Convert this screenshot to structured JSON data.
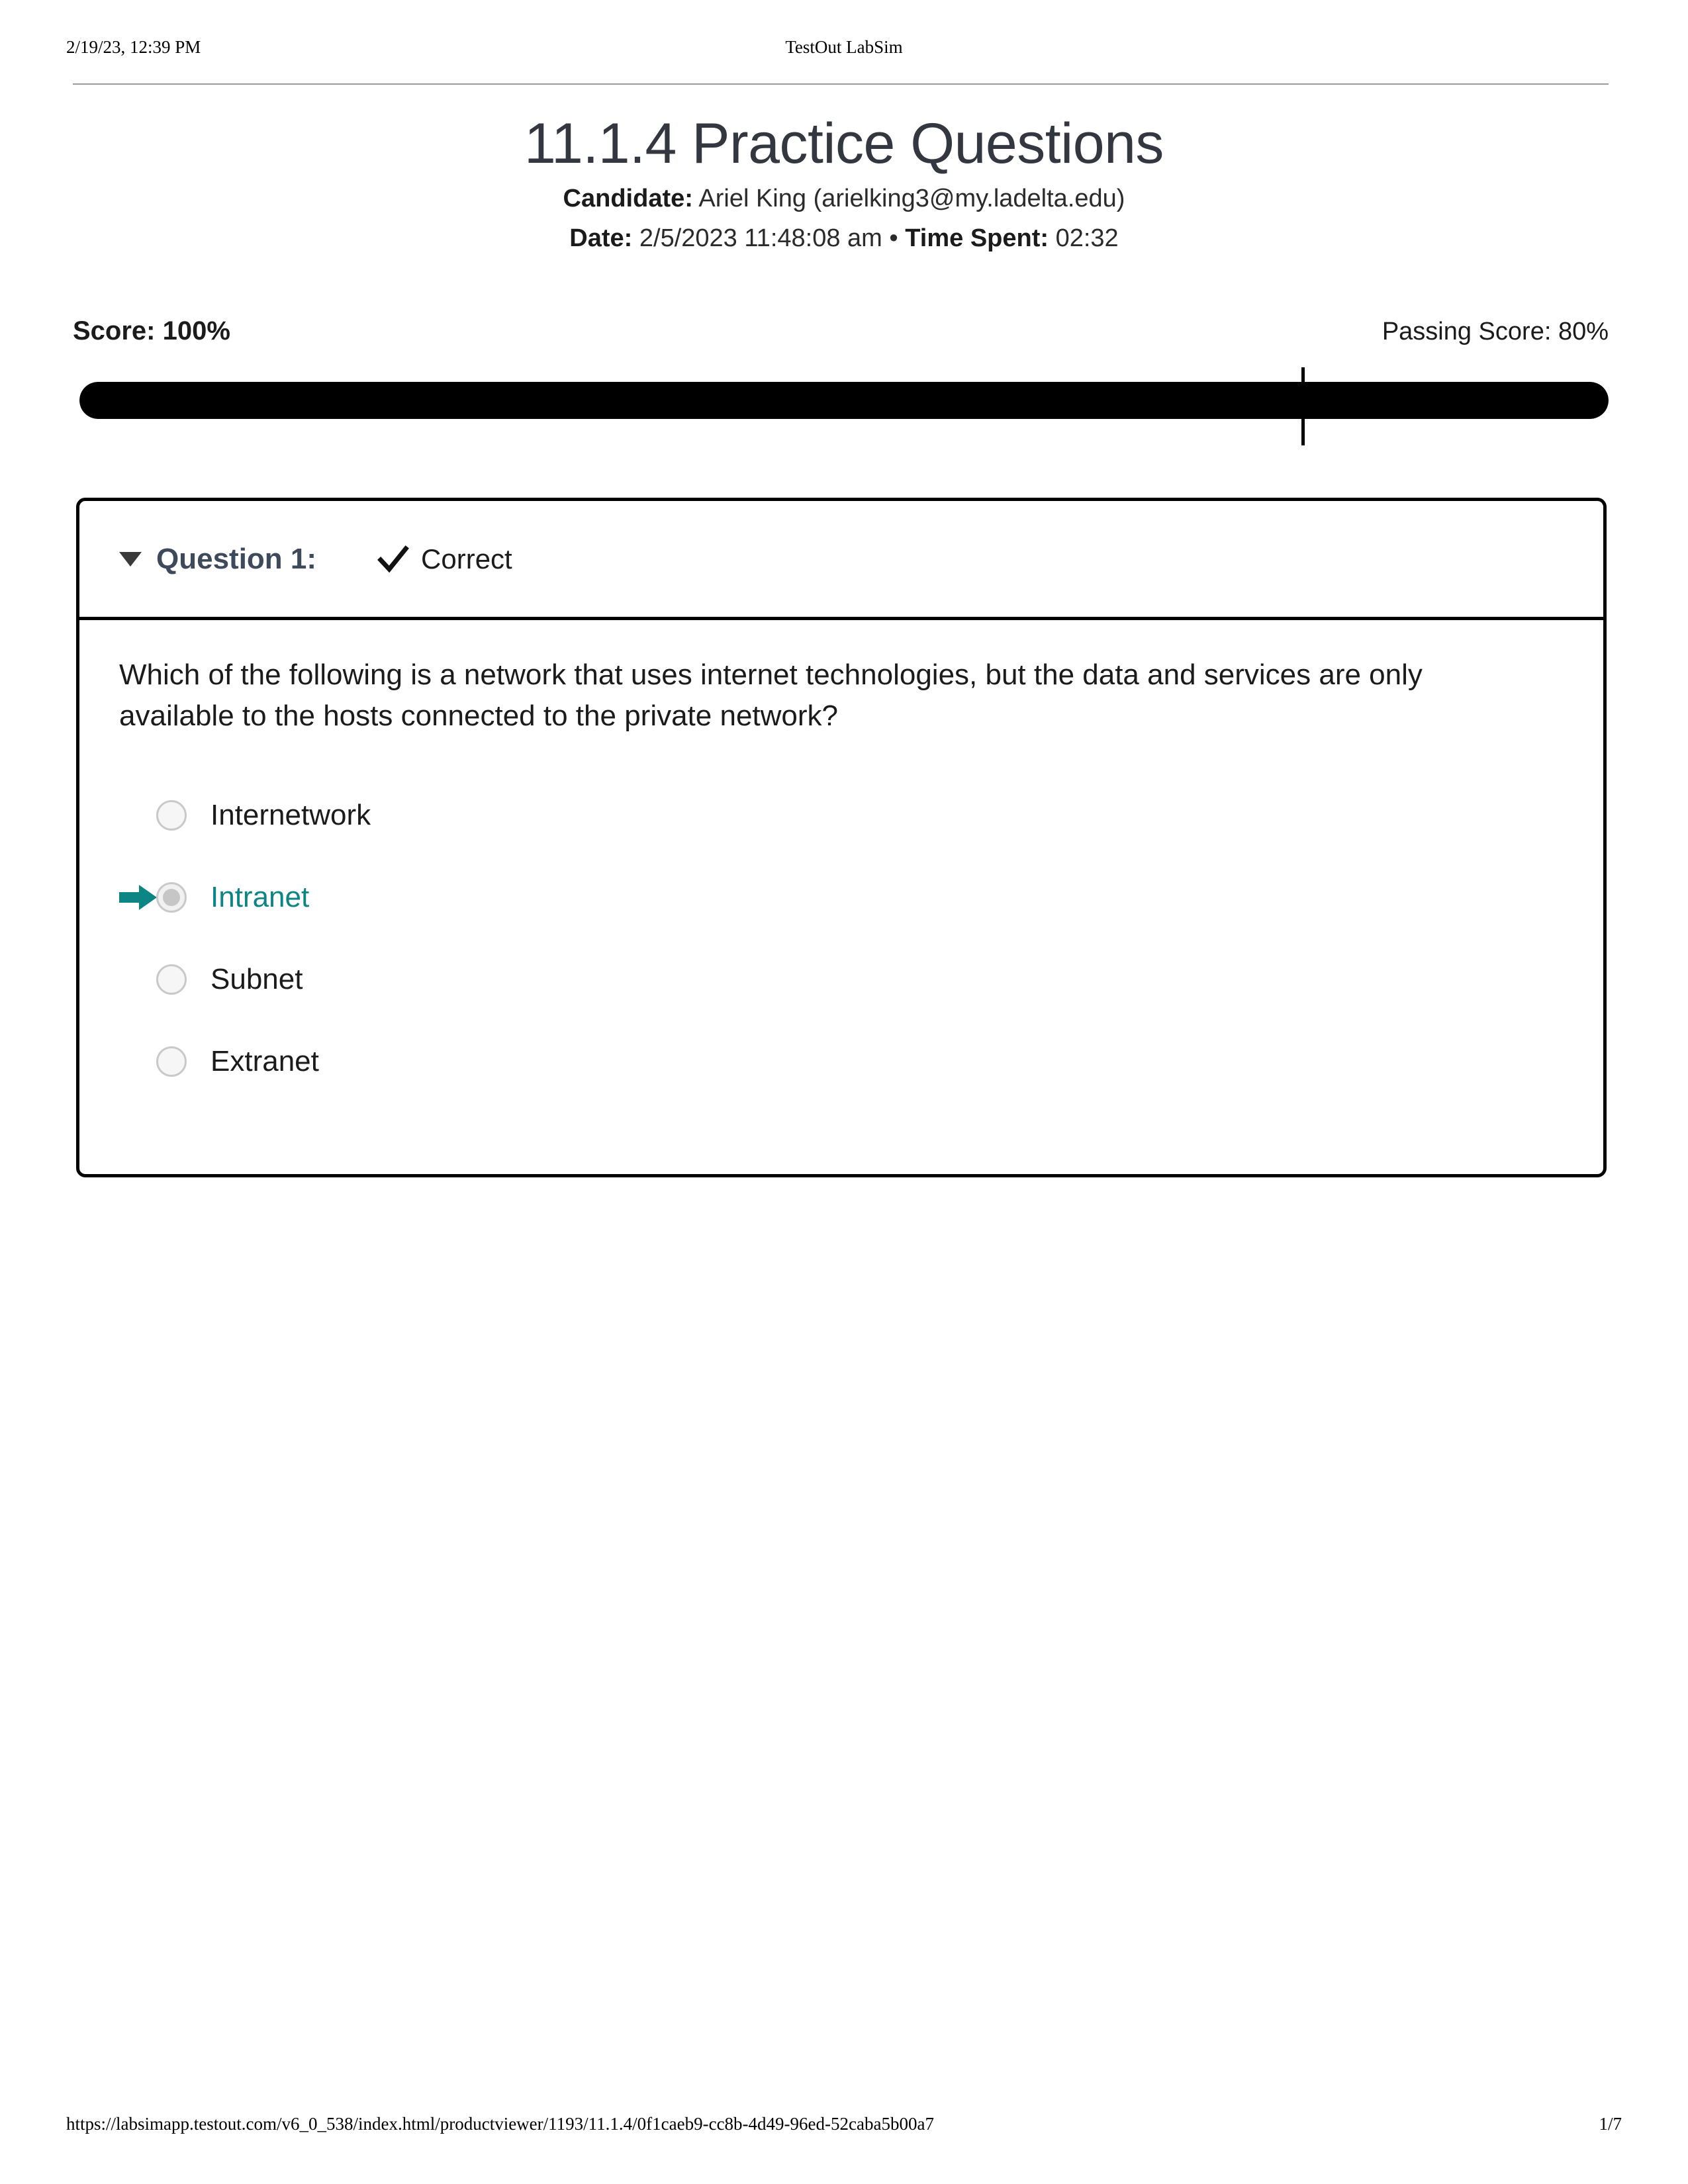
{
  "print_header": {
    "left": "2/19/23, 12:39 PM",
    "center": "TestOut LabSim"
  },
  "title": "11.1.4 Practice Questions",
  "meta": {
    "candidate_label": "Candidate:",
    "candidate_value": "Ariel King  (arielking3@my.ladelta.edu)",
    "date_label": "Date:",
    "date_value": "2/5/2023 11:48:08 am",
    "separator": "•",
    "time_spent_label": "Time Spent:",
    "time_spent_value": "02:32"
  },
  "score": {
    "score_text": "Score: 100%",
    "passing_text": "Passing Score: 80%",
    "score_percent": 100,
    "passing_percent": 80,
    "bar_fill_color": "#000000",
    "bar_track_color": "#e9e9e9",
    "tick_color": "#000000"
  },
  "question": {
    "caret_icon": "caret-down-icon",
    "label": "Question 1:",
    "status_icon": "checkmark-icon",
    "status_text": "Correct",
    "text": "Which of the following is a network that uses internet technologies, but the data and services are only available to the hosts connected to the private network?",
    "selected_color": "#0d8585",
    "options": [
      {
        "label": "Internetwork",
        "selected": false,
        "arrow_icon": null
      },
      {
        "label": "Intranet",
        "selected": true,
        "arrow_icon": "arrow-right-icon"
      },
      {
        "label": "Subnet",
        "selected": false,
        "arrow_icon": null
      },
      {
        "label": "Extranet",
        "selected": false,
        "arrow_icon": null
      }
    ]
  },
  "print_footer": {
    "url": "https://labsimapp.testout.com/v6_0_538/index.html/productviewer/1193/11.1.4/0f1caeb9-cc8b-4d49-96ed-52caba5b00a7",
    "page": "1/7"
  }
}
